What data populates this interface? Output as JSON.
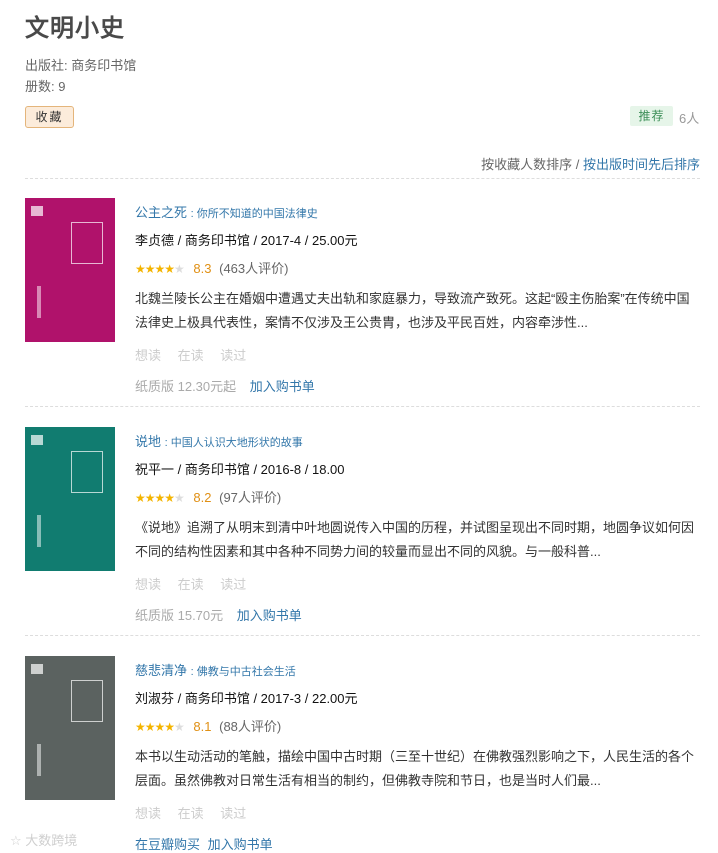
{
  "page": {
    "title": "文明小史",
    "publisher": "出版社: 商务印书馆",
    "volumes": "册数:  9",
    "collect_label": "收藏",
    "recommend_label": "推荐",
    "recommend_count": "6人"
  },
  "sort": {
    "by_collect": "按收藏人数排序",
    "separator": "/",
    "by_date": "按出版时间先后排序"
  },
  "books": [
    {
      "title": "公主之死",
      "subtitle": ": 你所不知道的中国法律史",
      "pub": "李贞德 / 商务印书馆 / 2017-4 / 25.00元",
      "stars": "★★★★",
      "stars_off": "★",
      "score": "8.3",
      "ratings": "(463人评价)",
      "desc": "北魏兰陵长公主在婚姻中遭遇丈夫出轨和家庭暴力，导致流产致死。这起“殴主伤胎案”在传统中国法律史上极具代表性，案情不仅涉及王公贵胄，也涉及平民百姓，内容牵涉性...",
      "want": "想读",
      "reading": "在读",
      "read": "读过",
      "price": "纸质版 12.30元起",
      "cart": "加入购书单",
      "cover_color": "#b0126b"
    },
    {
      "title": "说地",
      "subtitle": ": 中国人认识大地形状的故事",
      "pub": "祝平一 / 商务印书馆 / 2016-8 / 18.00",
      "stars": "★★★★",
      "stars_off": "★",
      "score": "8.2",
      "ratings": "(97人评价)",
      "desc": "《说地》追溯了从明末到清中叶地圆说传入中国的历程，并试图呈现出不同时期，地圆争议如何因不同的结构性因素和其中各种不同势力间的较量而显出不同的风貌。与一般科普...",
      "want": "想读",
      "reading": "在读",
      "read": "读过",
      "price": "纸质版 15.70元",
      "cart": "加入购书单",
      "cover_color": "#117c70"
    },
    {
      "title": "慈悲清净",
      "subtitle": ": 佛教与中古社会生活",
      "pub": "刘淑芬 / 商务印书馆 / 2017-3 / 22.00元",
      "stars": "★★★★",
      "stars_off": "★",
      "score": "8.1",
      "ratings": "(88人评价)",
      "desc": "本书以生动活动的笔触，描绘中国中古时期（三至十世纪）在佛教强烈影响之下，人民生活的各个层面。虽然佛教对日常生活有相当的制约，但佛教寺院和节日，也是当时人们最...",
      "want": "想读",
      "reading": "在读",
      "read": "读过",
      "buy_link": "在豆瓣购买",
      "cart": "加入购书单",
      "cover_color": "#5b6260"
    }
  ],
  "watermark": "大数跨境"
}
